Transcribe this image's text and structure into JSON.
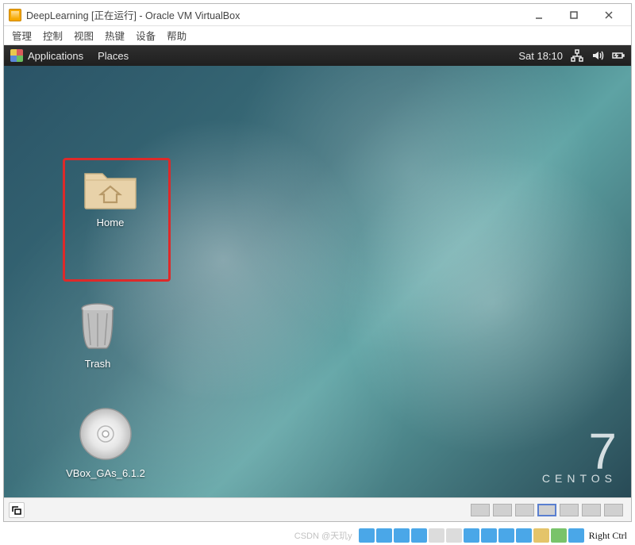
{
  "outer": {
    "title": "DeepLearning [正在运行] - Oracle VM VirtualBox",
    "menu": {
      "manage": "管理",
      "control": "控制",
      "view": "视图",
      "hotkeys": "热键",
      "devices": "设备",
      "help": "帮助"
    }
  },
  "guest": {
    "topbar": {
      "applications": "Applications",
      "places": "Places",
      "clock": "Sat 18:10"
    },
    "desktop": {
      "home_label": "Home",
      "trash_label": "Trash",
      "disc_label": "VBox_GAs_6.1.2"
    },
    "brand": {
      "version": "7",
      "name": "CENTOS"
    }
  },
  "host_tray": {
    "watermark": "CSDN @天玑y",
    "right_ctrl": "Right Ctrl"
  }
}
